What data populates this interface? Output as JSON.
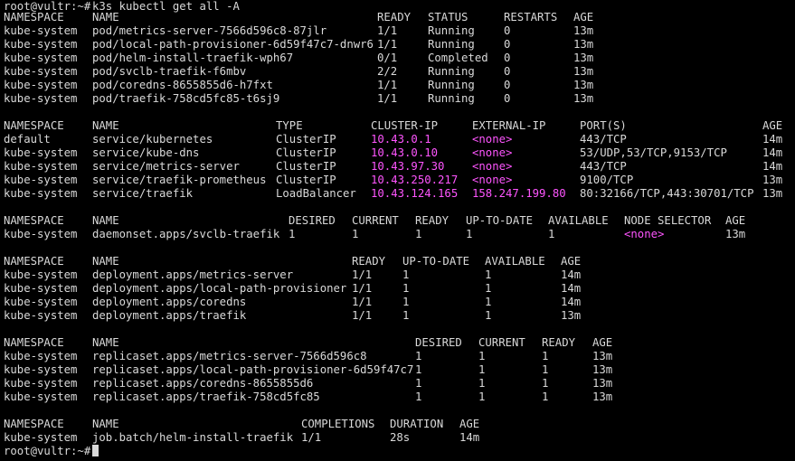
{
  "terminal": {
    "prompt": "root@vultr:~#",
    "command": "k3s kubectl get all -A",
    "accent_color": "#ff55ff"
  },
  "pods": {
    "headers": [
      "NAMESPACE",
      "NAME",
      "READY",
      "STATUS",
      "RESTARTS",
      "AGE"
    ],
    "rows": [
      [
        "kube-system",
        "pod/metrics-server-7566d596c8-87jlr",
        "1/1",
        "Running",
        "0",
        "13m"
      ],
      [
        "kube-system",
        "pod/local-path-provisioner-6d59f47c7-dnwr6",
        "1/1",
        "Running",
        "0",
        "13m"
      ],
      [
        "kube-system",
        "pod/helm-install-traefik-wph67",
        "0/1",
        "Completed",
        "0",
        "13m"
      ],
      [
        "kube-system",
        "pod/svclb-traefik-f6mbv",
        "2/2",
        "Running",
        "0",
        "13m"
      ],
      [
        "kube-system",
        "pod/coredns-8655855d6-h7fxt",
        "1/1",
        "Running",
        "0",
        "13m"
      ],
      [
        "kube-system",
        "pod/traefik-758cd5fc85-t6sj9",
        "1/1",
        "Running",
        "0",
        "13m"
      ]
    ]
  },
  "services": {
    "headers": [
      "NAMESPACE",
      "NAME",
      "TYPE",
      "CLUSTER-IP",
      "EXTERNAL-IP",
      "PORT(S)",
      "AGE"
    ],
    "rows": [
      [
        "default",
        "service/kubernetes",
        "ClusterIP",
        "10.43.0.1",
        "<none>",
        "443/TCP",
        "14m"
      ],
      [
        "kube-system",
        "service/kube-dns",
        "ClusterIP",
        "10.43.0.10",
        "<none>",
        "53/UDP,53/TCP,9153/TCP",
        "14m"
      ],
      [
        "kube-system",
        "service/metrics-server",
        "ClusterIP",
        "10.43.97.30",
        "<none>",
        "443/TCP",
        "14m"
      ],
      [
        "kube-system",
        "service/traefik-prometheus",
        "ClusterIP",
        "10.43.250.217",
        "<none>",
        "9100/TCP",
        "13m"
      ],
      [
        "kube-system",
        "service/traefik",
        "LoadBalancer",
        "10.43.124.165",
        "158.247.199.80",
        "80:32166/TCP,443:30701/TCP",
        "13m"
      ]
    ]
  },
  "daemonsets": {
    "headers": [
      "NAMESPACE",
      "NAME",
      "DESIRED",
      "CURRENT",
      "READY",
      "UP-TO-DATE",
      "AVAILABLE",
      "NODE SELECTOR",
      "AGE"
    ],
    "rows": [
      [
        "kube-system",
        "daemonset.apps/svclb-traefik",
        "1",
        "1",
        "1",
        "1",
        "1",
        "<none>",
        "13m"
      ]
    ]
  },
  "deployments": {
    "headers": [
      "NAMESPACE",
      "NAME",
      "READY",
      "UP-TO-DATE",
      "AVAILABLE",
      "AGE"
    ],
    "rows": [
      [
        "kube-system",
        "deployment.apps/metrics-server",
        "1/1",
        "1",
        "1",
        "14m"
      ],
      [
        "kube-system",
        "deployment.apps/local-path-provisioner",
        "1/1",
        "1",
        "1",
        "14m"
      ],
      [
        "kube-system",
        "deployment.apps/coredns",
        "1/1",
        "1",
        "1",
        "14m"
      ],
      [
        "kube-system",
        "deployment.apps/traefik",
        "1/1",
        "1",
        "1",
        "13m"
      ]
    ]
  },
  "replicasets": {
    "headers": [
      "NAMESPACE",
      "NAME",
      "DESIRED",
      "CURRENT",
      "READY",
      "AGE"
    ],
    "rows": [
      [
        "kube-system",
        "replicaset.apps/metrics-server-7566d596c8",
        "1",
        "1",
        "1",
        "13m"
      ],
      [
        "kube-system",
        "replicaset.apps/local-path-provisioner-6d59f47c7",
        "1",
        "1",
        "1",
        "13m"
      ],
      [
        "kube-system",
        "replicaset.apps/coredns-8655855d6",
        "1",
        "1",
        "1",
        "13m"
      ],
      [
        "kube-system",
        "replicaset.apps/traefik-758cd5fc85",
        "1",
        "1",
        "1",
        "13m"
      ]
    ]
  },
  "jobs": {
    "headers": [
      "NAMESPACE",
      "NAME",
      "COMPLETIONS",
      "DURATION",
      "AGE"
    ],
    "rows": [
      [
        "kube-system",
        "job.batch/helm-install-traefik",
        "1/1",
        "28s",
        "14m"
      ]
    ]
  }
}
